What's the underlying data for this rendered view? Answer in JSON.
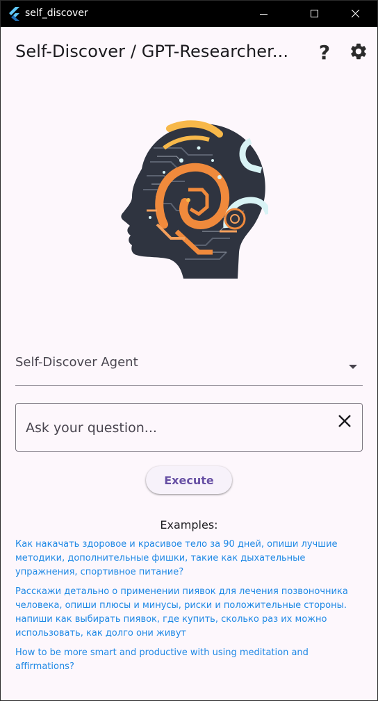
{
  "window": {
    "title": "self_discover"
  },
  "appbar": {
    "title": "Self-Discover / GPT-Researcher...",
    "help_glyph": "?"
  },
  "colors": {
    "background": "#fdf7fc",
    "accent": "#6750a4",
    "link": "#1e88e5",
    "titlebar": "#000000",
    "logo_orange": "#f08a3c",
    "logo_yellow": "#f7b84a",
    "logo_cyan": "#d8f3f5",
    "logo_dark": "#2f3440"
  },
  "agent_select": {
    "value": "Self-Discover Agent"
  },
  "question": {
    "placeholder": "Ask your question...",
    "value": ""
  },
  "execute_label": "Execute",
  "examples": {
    "heading": "Examples:",
    "items": [
      "Как накачать здоровое и красивое тело за 90 дней, опиши лучшие методики, дополнительные фишки, такие как дыхательные упражнения, спортивное питание?",
      "Расскажи детально о применении пиявок для лечения позвоночника человека, опиши плюсы и минусы, риски и положительные стороны. напиши как выбирать пиявок, где купить, сколько раз их можно использовать, как долго они живут",
      "How to be more smart and productive with using meditation and affirmations?"
    ]
  },
  "icons": {
    "app": "flutter-icon",
    "minimize": "minimize-icon",
    "maximize": "maximize-icon",
    "close": "close-icon",
    "help": "help-icon",
    "settings": "gear-icon",
    "dropdown": "dropdown-arrow-icon",
    "clear": "clear-icon"
  }
}
